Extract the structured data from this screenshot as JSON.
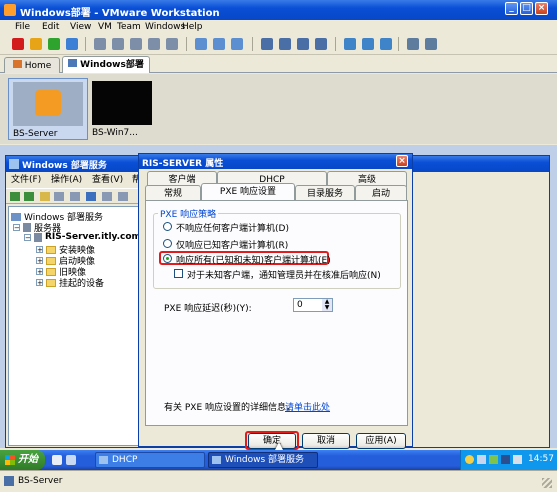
{
  "vmware": {
    "title": "Windows部署 - VMware Workstation",
    "menu": [
      "File",
      "Edit",
      "View",
      "VM",
      "Team",
      "Windows",
      "Help"
    ],
    "tabs": [
      {
        "label": "Home"
      },
      {
        "label": "Windows部署"
      }
    ],
    "thumbnails": [
      {
        "label": "BS-Server"
      },
      {
        "label": "BS-Win7..."
      }
    ],
    "status_text": "BS-Server"
  },
  "mmc": {
    "title": "Windows 部署服务",
    "menu": [
      "文件(F)",
      "操作(A)",
      "查看(V)",
      "帮"
    ],
    "tree": [
      "Windows 部署服务",
      "服务器",
      "RIS-Server.itly.com",
      "安装映像",
      "启动映像",
      "旧映像",
      "挂起的设备"
    ]
  },
  "dialog": {
    "title": "RIS-SERVER 属性",
    "tabs_back": [
      "客户端",
      "DHCP",
      "高级"
    ],
    "tabs_front": [
      "常规",
      "PXE 响应设置",
      "目录服务",
      "启动"
    ],
    "group_title": "PXE 响应策略",
    "options": [
      {
        "label": "不响应任何客户端计算机(D)",
        "selected": false
      },
      {
        "label": "仅响应已知客户端计算机(R)",
        "selected": false
      },
      {
        "label": "响应所有(已知和未知)客户端计算机(E)",
        "selected": true
      }
    ],
    "checkbox_label": "对于未知客户端，通知管理员并在核准后响应(N)",
    "delay_label": "PXE 响应延迟(秒)(Y):",
    "delay_value": "0",
    "info_text": "有关 PXE 响应设置的详细信息，",
    "info_link": "请单击此处",
    "ok": "确定",
    "cancel": "取消",
    "apply": "应用(A)"
  },
  "taskbar": {
    "start": "开始",
    "items": [
      {
        "label": "DHCP"
      },
      {
        "label": "Windows 部署服务"
      }
    ],
    "clock": "14:57"
  }
}
